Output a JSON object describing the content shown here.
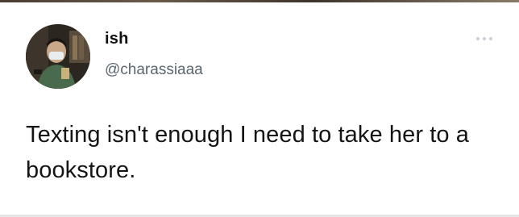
{
  "tweet": {
    "display_name": "ish",
    "handle": "@charassiaaa",
    "text": "Texting isn't enough I need to take her to a bookstore.",
    "avatar_icon": "profile-photo",
    "more_icon": "more-options-icon"
  },
  "colors": {
    "background": "#ffffff",
    "name": "#111111",
    "handle": "#5b6670",
    "text": "#141414",
    "more_dots": "#c9cfd5"
  }
}
